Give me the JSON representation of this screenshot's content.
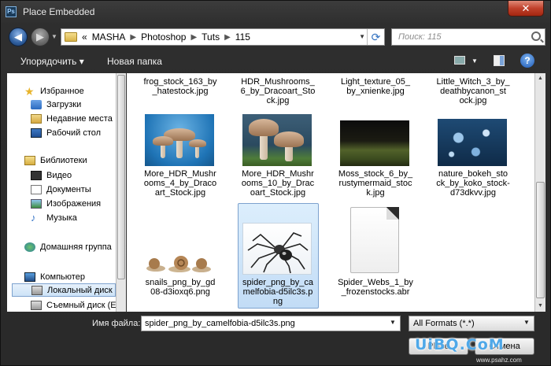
{
  "window": {
    "title": "Place Embedded",
    "app_icon_text": "Ps",
    "close_glyph": "✕"
  },
  "nav": {
    "back_glyph": "◀",
    "forward_glyph": "▶",
    "breadcrumb_prefix": "«",
    "breadcrumb": [
      "MASHA",
      "Photoshop",
      "Tuts",
      "115"
    ],
    "search_placeholder": "Поиск: 115"
  },
  "toolbar": {
    "organize": "Упорядочить ▾",
    "new_folder": "Новая папка",
    "help": "?"
  },
  "sidebar": {
    "items": [
      {
        "label": "Избранное",
        "icon": "star-icon"
      },
      {
        "label": "Загрузки",
        "icon": "downloads-icon"
      },
      {
        "label": "Недавние места",
        "icon": "recent-places-icon"
      },
      {
        "label": "Рабочий стол",
        "icon": "desktop-icon"
      },
      {
        "label": "Библиотеки",
        "icon": "libraries-icon"
      },
      {
        "label": "Видео",
        "icon": "video-icon"
      },
      {
        "label": "Документы",
        "icon": "documents-icon"
      },
      {
        "label": "Изображения",
        "icon": "images-icon"
      },
      {
        "label": "Музыка",
        "icon": "music-icon"
      },
      {
        "label": "Домашняя группа",
        "icon": "homegroup-icon"
      },
      {
        "label": "Компьютер",
        "icon": "computer-icon"
      },
      {
        "label": "Локальный диск",
        "icon": "local-disk-icon"
      },
      {
        "label": "Съемный диск (E",
        "icon": "removable-disk-icon"
      }
    ]
  },
  "files": {
    "top_row": [
      "frog_stock_163_by\n_hatestock.jpg",
      "HDR_Mushrooms_\n6_by_Dracoart_Sto\nck.jpg",
      "Light_texture_05_\nby_xnienke.jpg",
      "Little_Witch_3_by_\ndeathbycanon_st\nock.jpg"
    ],
    "middle_row": [
      "More_HDR_Mushr\nooms_4_by_Draco\nart_Stock.jpg",
      "More_HDR_Mushr\nooms_10_by_Drac\noart_Stock.jpg",
      "Moss_stock_6_by_\nrustymermaid_stoc\nk.jpg",
      "nature_bokeh_sto\nck_by_koko_stock-\nd73dkvv.jpg"
    ],
    "bottom_row": [
      "snails_png_by_gd\n08-d3ioxq6.png",
      "spider_png_by_ca\nmelfobia-d5ilc3s.p\nng",
      "Spider_Webs_1_by\n_frozenstocks.abr"
    ]
  },
  "footer": {
    "filename_label": "Имя файла:",
    "filename_value": "spider_png_by_camelfobia-d5ilc3s.png",
    "format_value": "All Formats (*.*)",
    "place_button": "Place",
    "cancel_button": "Отмена"
  },
  "watermark": {
    "text": "UiBQ.CoM",
    "url": "www.psahz.com"
  }
}
